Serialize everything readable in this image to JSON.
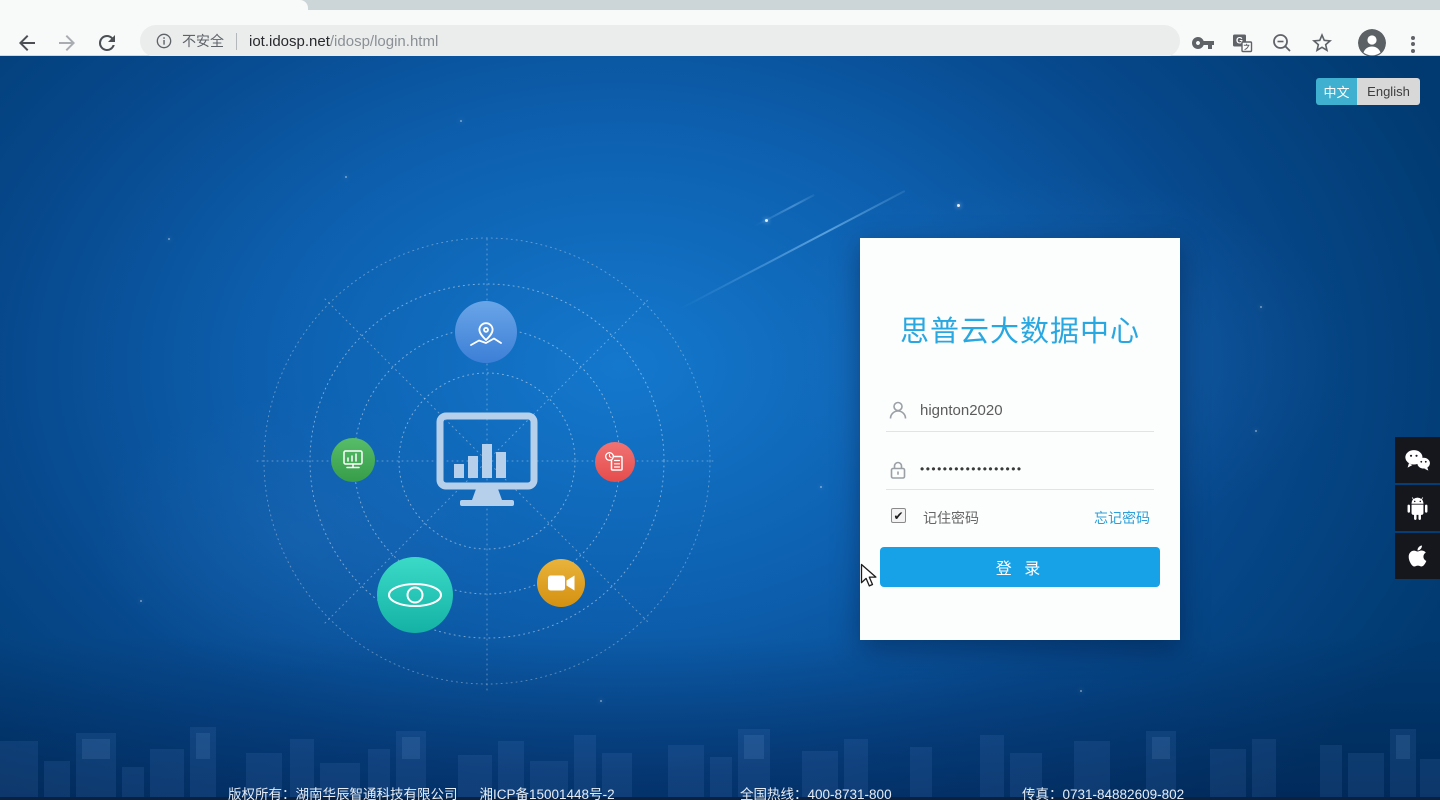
{
  "browser": {
    "security_label": "不安全",
    "url_host": "iot.idosp.net",
    "url_path": "/idosp/login.html"
  },
  "language_toggle": {
    "zh_label": "中文",
    "en_label": "English",
    "active": "中文"
  },
  "login_card": {
    "title": "思普云大数据中心",
    "username_value": "hignton2020",
    "password_mask": "••••••••••••••••••",
    "remember_label": "记住密码",
    "remember_checked": true,
    "check_glyph": "✔",
    "forgot_link": "忘记密码",
    "login_button": "登 录"
  },
  "footer": {
    "copyright": "版权所有：湖南华辰智通科技有限公司",
    "icp": "湘ICP备15001448号-2",
    "hotline": "全国热线：400-8731-800",
    "fax": "传真：0731-84882609-802"
  },
  "colors": {
    "accent_button_blue": "#17a2e8",
    "title_blue": "#29a7e1",
    "link_blue": "#2b9fd9",
    "toggle_teal": "#3fb0cf",
    "bg_center_blue": "#1478cd",
    "bg_edge_navy": "#013a70",
    "satellite_blue": "#4a8fdd",
    "satellite_green": "#46ad57",
    "satellite_red": "#ec5d5d",
    "satellite_teal": "#23c6b6",
    "satellite_orange": "#dca11c"
  },
  "icons": {
    "toolbar": [
      "back-arrow",
      "forward-arrow",
      "reload",
      "page-info",
      "key",
      "translate",
      "zoom-out-magnifier",
      "bookmark-star",
      "profile-avatar",
      "three-dots-menu"
    ],
    "login_fields": [
      "person-outline",
      "lock-outline"
    ],
    "side_apps": [
      "wechat",
      "android",
      "apple"
    ],
    "radar_graphic": [
      "dashboard-monitor",
      "map-pin",
      "monitor-chart",
      "report-doc",
      "eye",
      "video-camera"
    ]
  }
}
